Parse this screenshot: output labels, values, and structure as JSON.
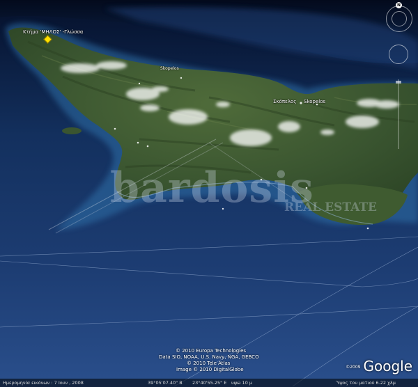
{
  "map": {
    "placemark_label": "Κτήμα 'ΜΗΛΟΣ' -Γλώσσα",
    "place_labels": [
      "Skopelos",
      "Σκόπελος",
      "Skopelos"
    ]
  },
  "watermark": {
    "main": "bardosis",
    "sub": "REAL ESTATE"
  },
  "credits": {
    "line1": "© 2010 Europa Technologies",
    "line2": "Data SIO, NOAA, U.S. Navy, NGA, GEBCO",
    "line3": "© 2010 Tele Atlas",
    "line4": "Image © 2010 DigitalGlobe"
  },
  "logo": {
    "year": "©2009",
    "text": "Google"
  },
  "status_bar": {
    "imagery_date": "Ημερομηνία εικόνων : 7 Ιουν  , 2008",
    "latitude": "39°05'07.40\" B",
    "longitude": "23°40'55.25\" E",
    "elevation": "υψώ   10 μ",
    "eye_alt": "Ύψος του ματιού     6.22 χλμ"
  },
  "nav_controls": {
    "north_label": "N"
  },
  "colors": {
    "sea_deep": "#0b1a3a",
    "sea_shallow": "#1f4a82",
    "land": "#3e5a2e",
    "placemark": "#ffe000"
  }
}
